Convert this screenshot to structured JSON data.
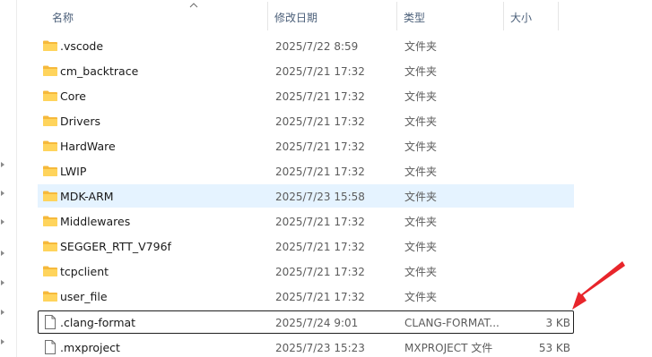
{
  "columns": {
    "name": "名称",
    "date_modified": "修改日期",
    "type": "类型",
    "size": "大小"
  },
  "sort": {
    "column": "name",
    "direction": "ascending"
  },
  "accent_colors": {
    "selection": "#e5f3ff",
    "annotation_arrow": "#e8252b",
    "folder": "#ffc83d"
  },
  "files": [
    {
      "name": ".vscode",
      "date": "2025/7/22 8:59",
      "type": "文件夹",
      "size": "",
      "icon": "folder-icon"
    },
    {
      "name": "cm_backtrace",
      "date": "2025/7/21 17:32",
      "type": "文件夹",
      "size": "",
      "icon": "folder-icon"
    },
    {
      "name": "Core",
      "date": "2025/7/21 17:32",
      "type": "文件夹",
      "size": "",
      "icon": "folder-icon"
    },
    {
      "name": "Drivers",
      "date": "2025/7/21 17:32",
      "type": "文件夹",
      "size": "",
      "icon": "folder-icon"
    },
    {
      "name": "HardWare",
      "date": "2025/7/21 17:32",
      "type": "文件夹",
      "size": "",
      "icon": "folder-icon"
    },
    {
      "name": "LWIP",
      "date": "2025/7/21 17:32",
      "type": "文件夹",
      "size": "",
      "icon": "folder-icon"
    },
    {
      "name": "MDK-ARM",
      "date": "2025/7/23 15:58",
      "type": "文件夹",
      "size": "",
      "icon": "folder-icon",
      "state": "hover-selected"
    },
    {
      "name": "Middlewares",
      "date": "2025/7/21 17:32",
      "type": "文件夹",
      "size": "",
      "icon": "folder-icon"
    },
    {
      "name": "SEGGER_RTT_V796f",
      "date": "2025/7/21 17:32",
      "type": "文件夹",
      "size": "",
      "icon": "folder-icon"
    },
    {
      "name": "tcpclient",
      "date": "2025/7/21 17:32",
      "type": "文件夹",
      "size": "",
      "icon": "folder-icon"
    },
    {
      "name": "user_file",
      "date": "2025/7/21 17:32",
      "type": "文件夹",
      "size": "",
      "icon": "folder-icon"
    },
    {
      "name": ".clang-format",
      "date": "2025/7/24 9:01",
      "type": "CLANG-FORMAT...",
      "size": "3 KB",
      "icon": "file-icon",
      "state": "outlined"
    },
    {
      "name": ".mxproject",
      "date": "2025/7/23 15:23",
      "type": "MXPROJECT 文件",
      "size": "53 KB",
      "icon": "file-icon"
    }
  ]
}
